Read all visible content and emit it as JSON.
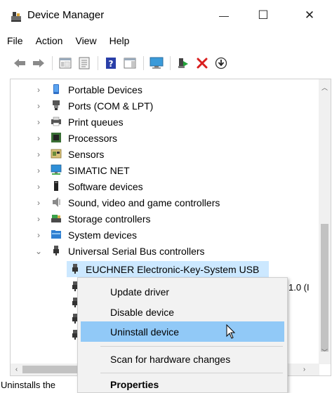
{
  "window": {
    "title": "Device Manager",
    "minimize_glyph": "—",
    "maximize_glyph": "☐",
    "close_glyph": "✕"
  },
  "menubar": [
    "File",
    "Action",
    "View",
    "Help"
  ],
  "toolbar": {
    "icons": [
      "back-icon",
      "forward-icon",
      "properties-window-icon",
      "console-tree-icon",
      "help-icon",
      "action-pane-icon",
      "monitor-icon",
      "update-driver-icon",
      "uninstall-icon",
      "install-icon"
    ]
  },
  "tree": {
    "items": [
      {
        "label": "Portable Devices",
        "icon": "portable-device-icon",
        "expanded": false
      },
      {
        "label": "Ports (COM & LPT)",
        "icon": "port-icon",
        "expanded": false
      },
      {
        "label": "Print queues",
        "icon": "printer-icon",
        "expanded": false
      },
      {
        "label": "Processors",
        "icon": "processor-icon",
        "expanded": false
      },
      {
        "label": "Sensors",
        "icon": "sensor-icon",
        "expanded": false
      },
      {
        "label": "SIMATIC NET",
        "icon": "network-icon",
        "expanded": false
      },
      {
        "label": "Software devices",
        "icon": "software-device-icon",
        "expanded": false
      },
      {
        "label": "Sound, video and game controllers",
        "icon": "speaker-icon",
        "expanded": false
      },
      {
        "label": "Storage controllers",
        "icon": "storage-icon",
        "expanded": false
      },
      {
        "label": "System devices",
        "icon": "system-folder-icon",
        "expanded": false
      },
      {
        "label": "Universal Serial Bus controllers",
        "icon": "usb-icon",
        "expanded": true
      }
    ],
    "selected_child": "EUCHNER Electronic-Key-System USB",
    "partial_text": "1.0 (I"
  },
  "context_menu": {
    "items": [
      {
        "label": "Update driver",
        "hover": false,
        "bold": false
      },
      {
        "label": "Disable device",
        "hover": false,
        "bold": false
      },
      {
        "label": "Uninstall device",
        "hover": true,
        "bold": false
      },
      {
        "label": "Scan for hardware changes",
        "hover": false,
        "bold": false
      },
      {
        "label": "Properties",
        "hover": false,
        "bold": true
      }
    ]
  },
  "statusbar": {
    "text": "Uninstalls the"
  },
  "colors": {
    "selection": "#cce8ff",
    "menu_hover": "#91c9f7",
    "menu_bg": "#f2f2f2"
  }
}
